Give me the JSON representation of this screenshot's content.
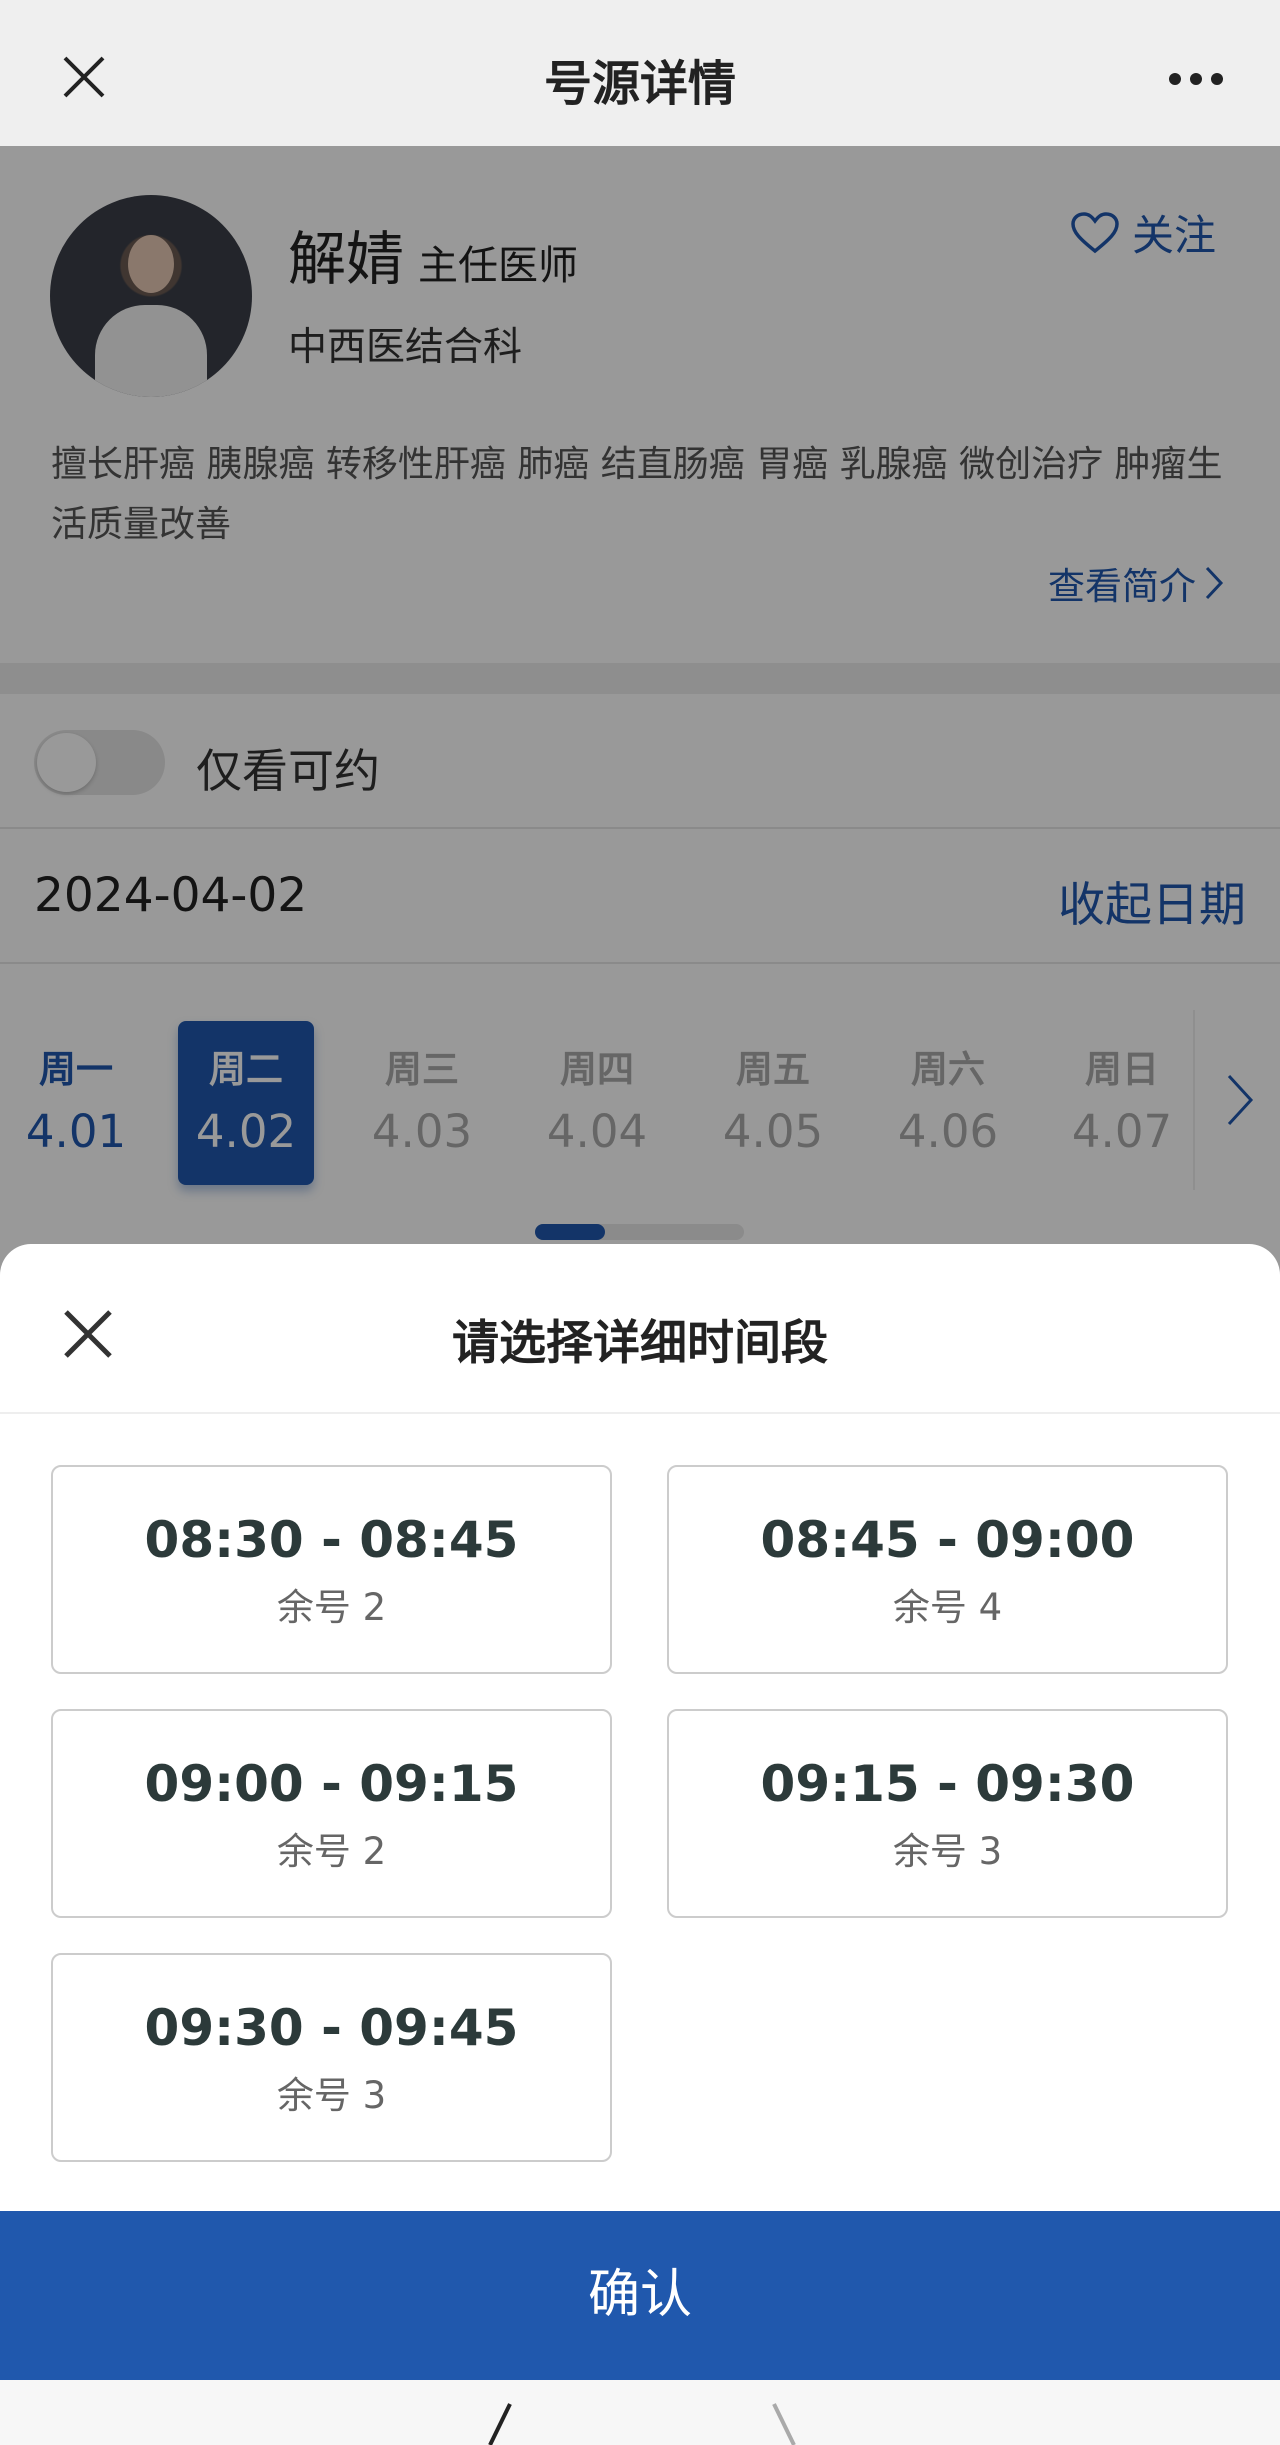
{
  "header": {
    "title": "号源详情",
    "close_icon": "close-icon",
    "more_icon": "more-dots-icon"
  },
  "doctor": {
    "name": "解婧",
    "rank": "主任医师",
    "department": "中西医结合科",
    "follow_label": "关注",
    "specialties": "擅长肝癌 胰腺癌 转移性肝癌 肺癌 结直肠癌 胃癌 乳腺癌 微创治疗 肿瘤生活质量改善",
    "intro_label": "查看简介"
  },
  "filter": {
    "only_available_label": "仅看可约",
    "only_available": false
  },
  "date_bar": {
    "date": "2024-04-02",
    "collapse_label": "收起日期"
  },
  "week": [
    {
      "day": "周一",
      "date": "4.01",
      "state": "available"
    },
    {
      "day": "周二",
      "date": "4.02",
      "state": "selected"
    },
    {
      "day": "周三",
      "date": "4.03",
      "state": "unavailable"
    },
    {
      "day": "周四",
      "date": "4.04",
      "state": "unavailable"
    },
    {
      "day": "周五",
      "date": "4.05",
      "state": "unavailable"
    },
    {
      "day": "周六",
      "date": "4.06",
      "state": "unavailable"
    },
    {
      "day": "周日",
      "date": "4.07",
      "state": "unavailable"
    }
  ],
  "sheet": {
    "title": "请选择详细时间段",
    "confirm_label": "确认",
    "slots": [
      {
        "time": "08:30 - 08:45",
        "remaining": "余号 2"
      },
      {
        "time": "08:45 - 09:00",
        "remaining": "余号 4"
      },
      {
        "time": "09:00 - 09:15",
        "remaining": "余号 2"
      },
      {
        "time": "09:15 - 09:30",
        "remaining": "余号 3"
      },
      {
        "time": "09:30 - 09:45",
        "remaining": "余号 3"
      }
    ]
  },
  "colors": {
    "accent": "#2058ad",
    "overlay": "rgba(0,0,0,0.4)"
  }
}
